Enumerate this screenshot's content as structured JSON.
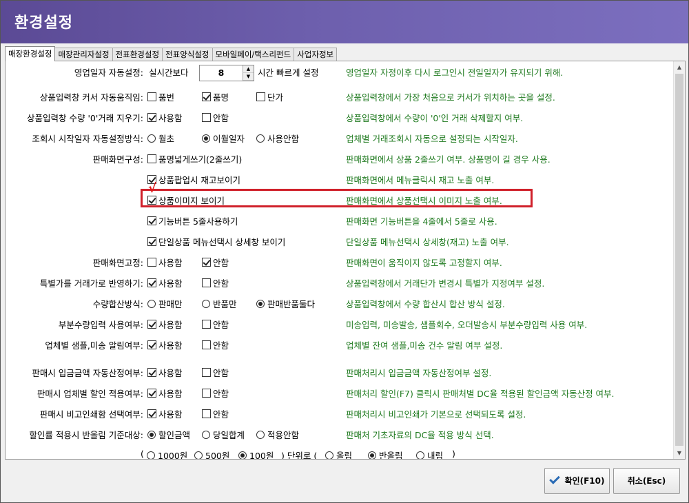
{
  "window": {
    "title": "환경설정"
  },
  "tabs": [
    "매장환경설정",
    "매장관리자설정",
    "전표환경설정",
    "전표양식설정",
    "모바일페이/택스리펀드",
    "사업자정보"
  ],
  "rows": {
    "r0": {
      "label": "영업일자 자동설정:",
      "pre": "실시간보다",
      "value": "8",
      "post": "시간 빠르게 설정",
      "desc": "영업일자 자정이후 다시 로그인시 전일일자가 유지되기 위해."
    },
    "r1": {
      "label": "상품입력창 커서 자동움직임:",
      "o1": "품번",
      "o2": "품명",
      "o3": "단가",
      "desc": "상품입력창에서 가장 처음으로 커서가 위치하는 곳을 설정."
    },
    "r2": {
      "label": "상품입력창 수량 '0'거래 지우기:",
      "o1": "사용함",
      "o2": "안함",
      "desc": "상품입력창에서 수량이 '0'인 거래 삭제할지 여부."
    },
    "r3": {
      "label": "조회시 시작일자 자동설정방식:",
      "o1": "월초",
      "o2": "이월일자",
      "o3": "사용안함",
      "desc": "업체별 거래조회시 자동으로 설정되는 시작일자."
    },
    "r4": {
      "label": "판매화면구성:",
      "o1": "품명넓게쓰기(2줄쓰기)",
      "desc": "판매화면에서 상품 2줄쓰기 여부. 상품명이 길 경우 사용."
    },
    "r5": {
      "o1": "상품팝업시 재고보이기",
      "desc": "판매화면에서 메뉴클릭시 재고 노출 여부."
    },
    "r6": {
      "o1": "상품이미지 보이기",
      "desc": "판매화면에서 상품선택시 이미지 노출 여부."
    },
    "r7": {
      "o1": "기능버튼 5줄사용하기",
      "desc": "판매화면 기능버튼을 4줄에서 5줄로 사용."
    },
    "r8": {
      "o1": "단일상품 메뉴선택시 상세창 보이기",
      "desc": "단일상품 메뉴선택시 상세창(재고) 노출 여부."
    },
    "r9": {
      "label": "판매화면고정:",
      "o1": "사용함",
      "o2": "안함",
      "desc": "판매화면이 움직이지 않도록 고정할지 여부."
    },
    "r10": {
      "label": "특별가를 거래가로 반영하기:",
      "o1": "사용함",
      "o2": "안함",
      "desc": "상품입력창에서 거래단가 변경시 특별가 지정여부 설정."
    },
    "r11": {
      "label": "수량합산방식:",
      "o1": "판매만",
      "o2": "반품만",
      "o3": "판매반품둘다",
      "desc": "상품입력창에서 수량 합산시 합산 방식 설정."
    },
    "r12": {
      "label": "부분수량입력 사용여부:",
      "o1": "사용함",
      "o2": "안함",
      "desc": "미송입력, 미송발송, 샘플회수, 오더발송시 부분수량입력 사용 여부."
    },
    "r13": {
      "label": "업체별 샘플,미송 알림여부:",
      "o1": "사용함",
      "o2": "안함",
      "desc": "업체별 잔여 샘플,미송 건수 알림 여부 설정."
    },
    "r14": {
      "label": "판매시 입금금액 자동산정여부:",
      "o1": "사용함",
      "o2": "안함",
      "desc": "판매처리시 입금금액 자동산정여부 설정."
    },
    "r15": {
      "label": "판매시 업체별 할인 적용여부:",
      "o1": "사용함",
      "o2": "안함",
      "desc": "판매처리 할인(F7) 클릭시 판매처별 DC율 적용된 할인금액 자동산정 여부."
    },
    "r16": {
      "label": "판매시 비고인쇄함 선택여부:",
      "o1": "사용함",
      "o2": "안함",
      "desc": "판매처리시 비고인쇄가 기본으로 선택되도록 설정."
    },
    "r17": {
      "label": "할인률 적용시 반올림 기준대상:",
      "o1": "할인금액",
      "o2": "당일합계",
      "o3": "적용안함",
      "desc": "판매처 기초자료의 DC율 적용 방식 선택."
    },
    "r18": {
      "open": "(",
      "o1": "1000원",
      "o2": "500원",
      "o3": "100원",
      "mid": ") 단위로 (",
      "o4": "올림",
      "o5": "반올림",
      "o6": "내림",
      "close": ")"
    }
  },
  "checked": {
    "r1": "o2",
    "r2": "o1",
    "r3": "o2",
    "r4": "none",
    "r5": "o1",
    "r6": "o1",
    "r7": "o1",
    "r8": "o1",
    "r9": "o2",
    "r10": "o1",
    "r11": "o3",
    "r12": "o1",
    "r13": "o1",
    "r14": "o1",
    "r15": "o1",
    "r16": "o1",
    "r17": "o1",
    "r18": [
      "o3",
      "o5"
    ]
  },
  "annotation": {
    "mark": "√",
    "color": "#d0202a"
  },
  "buttons": {
    "ok": "확인(F10)",
    "cancel": "취소(Esc)"
  },
  "colors": {
    "titlebar": "#6a5cad",
    "desc": "#1f7a1f",
    "highlight": "#d0202a"
  }
}
